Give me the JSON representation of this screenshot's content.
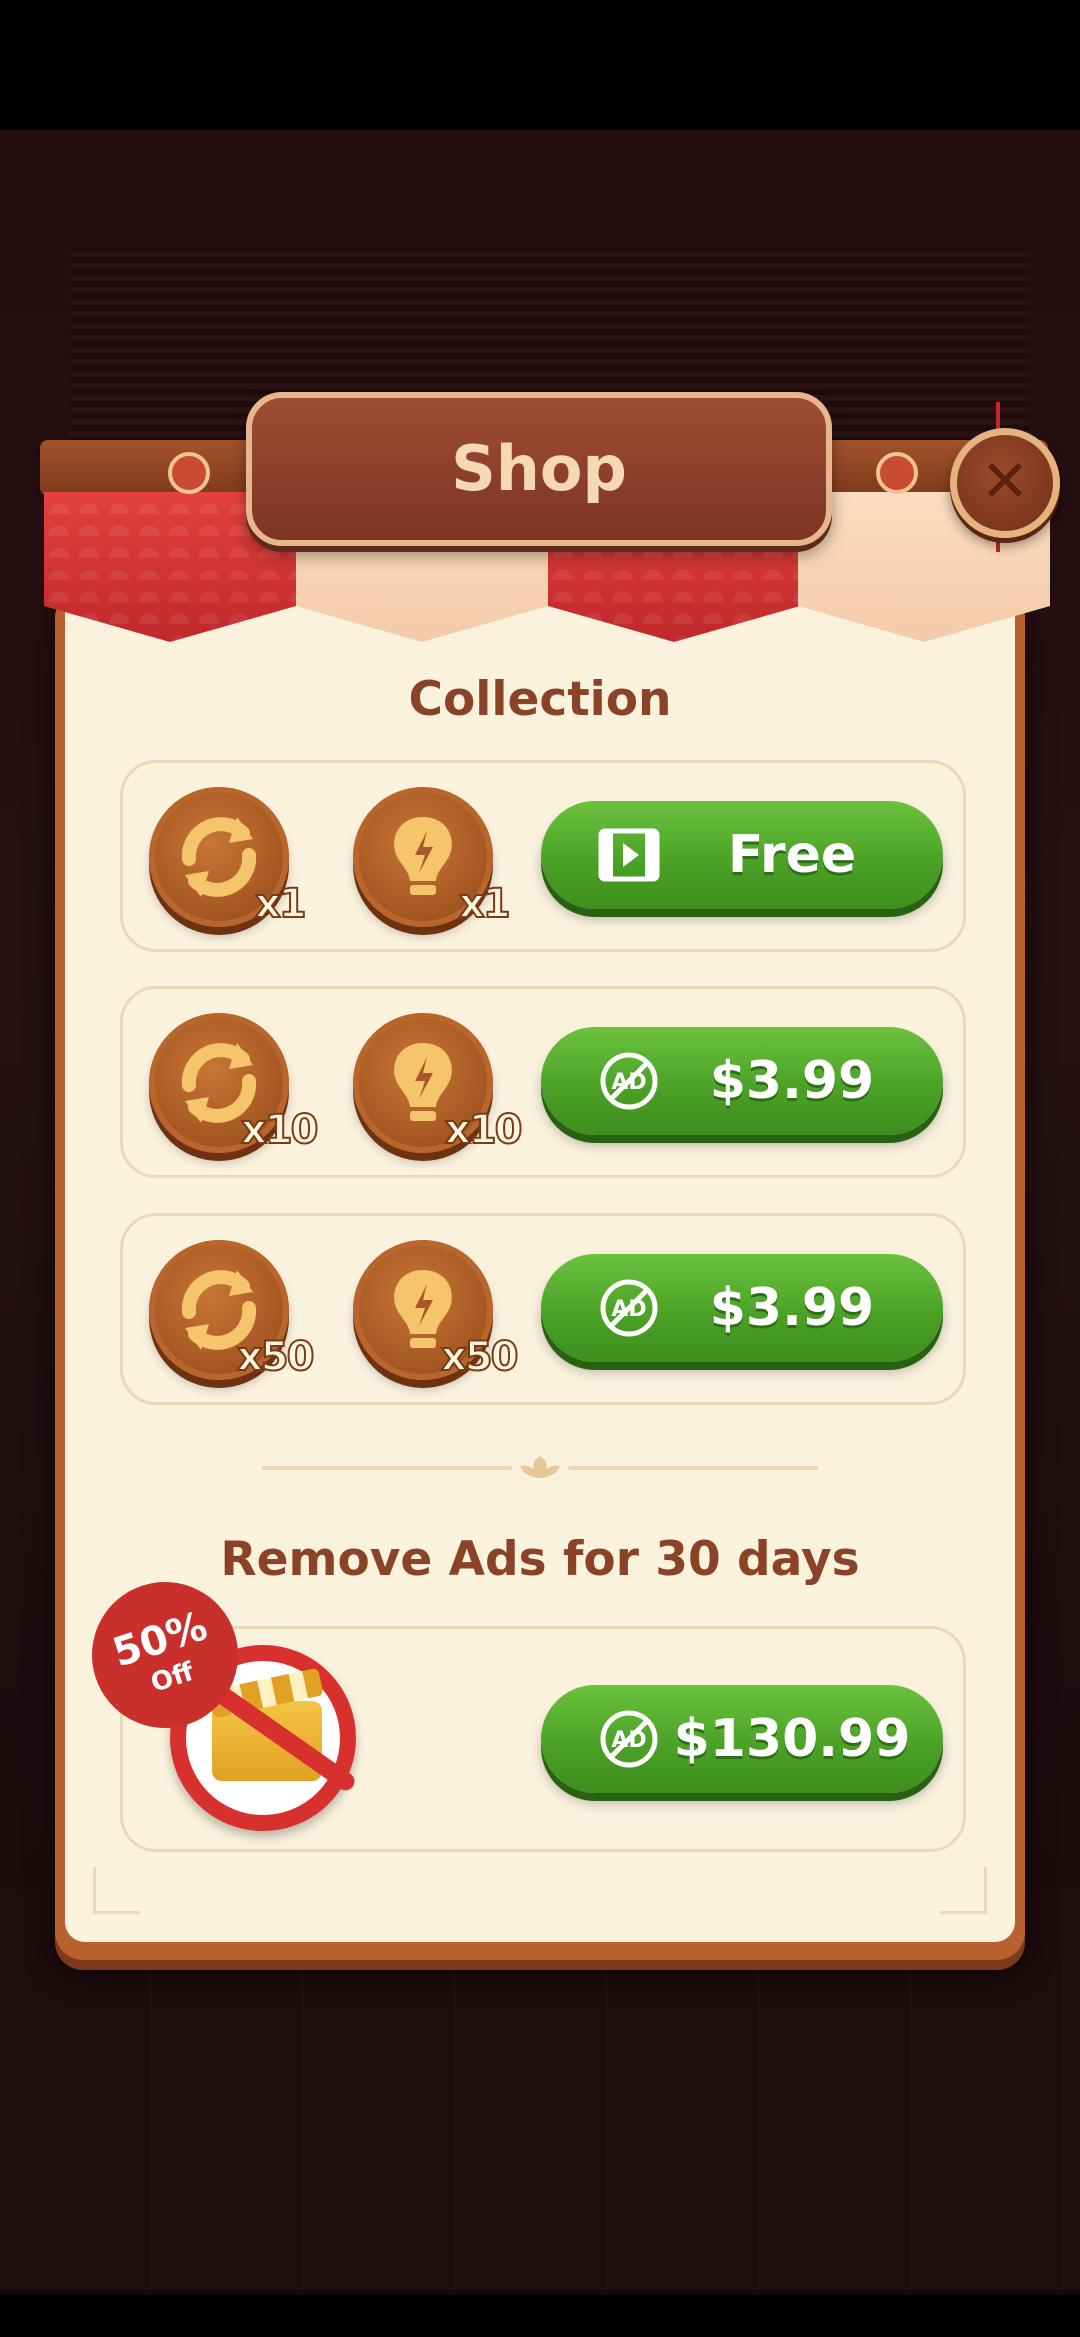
{
  "shop": {
    "title": "Shop",
    "close_label": "✕"
  },
  "collection": {
    "heading": "Collection",
    "offers": [
      {
        "shuffle_qty": "x1",
        "hint_qty": "x1",
        "price_label": "Free",
        "price_icon": "video-ad-icon"
      },
      {
        "shuffle_qty": "x10",
        "hint_qty": "x10",
        "price_label": "$3.99",
        "price_icon": "no-ads-icon"
      },
      {
        "shuffle_qty": "x50",
        "hint_qty": "x50",
        "price_label": "$3.99",
        "price_icon": "no-ads-icon"
      }
    ]
  },
  "remove_ads": {
    "heading": "Remove Ads for 30 days",
    "discount_percent": "50%",
    "discount_word": "Off",
    "price_label": "$130.99"
  },
  "colors": {
    "accent_green": "#4ba226",
    "heading_brown": "#8a4326",
    "panel_cream": "#fbf2de",
    "banner_red": "#c0282a"
  }
}
